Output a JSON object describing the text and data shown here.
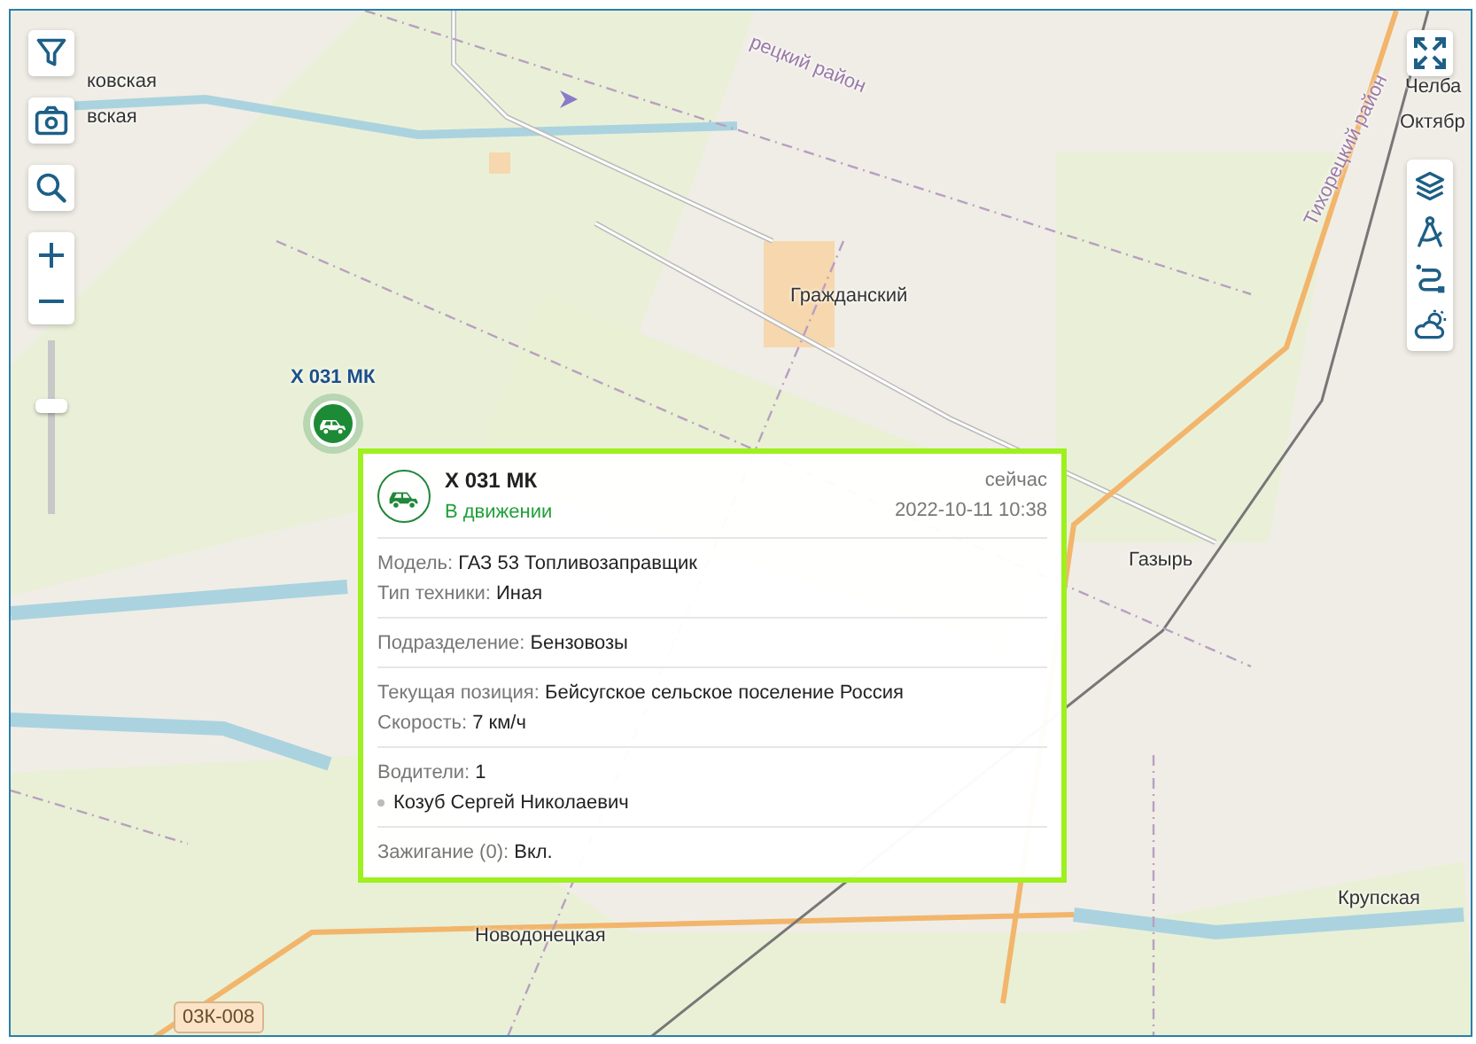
{
  "map": {
    "place_labels": [
      {
        "text": "ковская"
      },
      {
        "text": "вская"
      },
      {
        "text": "рецкий район",
        "kind": "district"
      },
      {
        "text": "Гражданский"
      },
      {
        "text": "Челба"
      },
      {
        "text": "Октябр"
      },
      {
        "text": "Тихорецкий район",
        "kind": "district"
      },
      {
        "text": "Газырь"
      },
      {
        "text": "Крупская"
      },
      {
        "text": "Новодонецкая"
      },
      {
        "text": "03К-008",
        "kind": "road"
      }
    ],
    "marker": {
      "label": "Х 031 МК",
      "moving": true
    }
  },
  "left_controls": [
    {
      "kind": "filter"
    },
    {
      "kind": "screenshot"
    },
    {
      "kind": "search"
    }
  ],
  "zoom_slider": {
    "level": 0.63
  },
  "right_controls": [
    {
      "kind": "layers"
    },
    {
      "kind": "measure"
    },
    {
      "kind": "route"
    },
    {
      "kind": "weather"
    }
  ],
  "popup": {
    "title": "Х 031 МК",
    "status": "В движении",
    "moving": true,
    "time_ago": "сейчас",
    "timestamp": "2022-10-11 10:38",
    "sections": [
      {
        "rows": [
          {
            "label": "Модель:",
            "value": "ГАЗ 53 Топливозаправщик"
          },
          {
            "label": "Тип техники:",
            "value": "Иная"
          }
        ]
      },
      {
        "rows": [
          {
            "label": "Подразделение:",
            "value": "Бензовозы"
          }
        ]
      },
      {
        "rows": [
          {
            "label": "Текущая позиция:",
            "value": "Бейсугское сельское поселение Россия"
          },
          {
            "label": "Скорость:",
            "value": "7 км/ч"
          }
        ]
      },
      {
        "rows": [
          {
            "label": "Водители:",
            "value": "1"
          },
          {
            "kind": "list-item",
            "value": "Козуб Сергей Николаевич"
          }
        ]
      },
      {
        "rows": [
          {
            "label": "Зажигание (0):",
            "value": "Вкл."
          }
        ]
      }
    ]
  }
}
